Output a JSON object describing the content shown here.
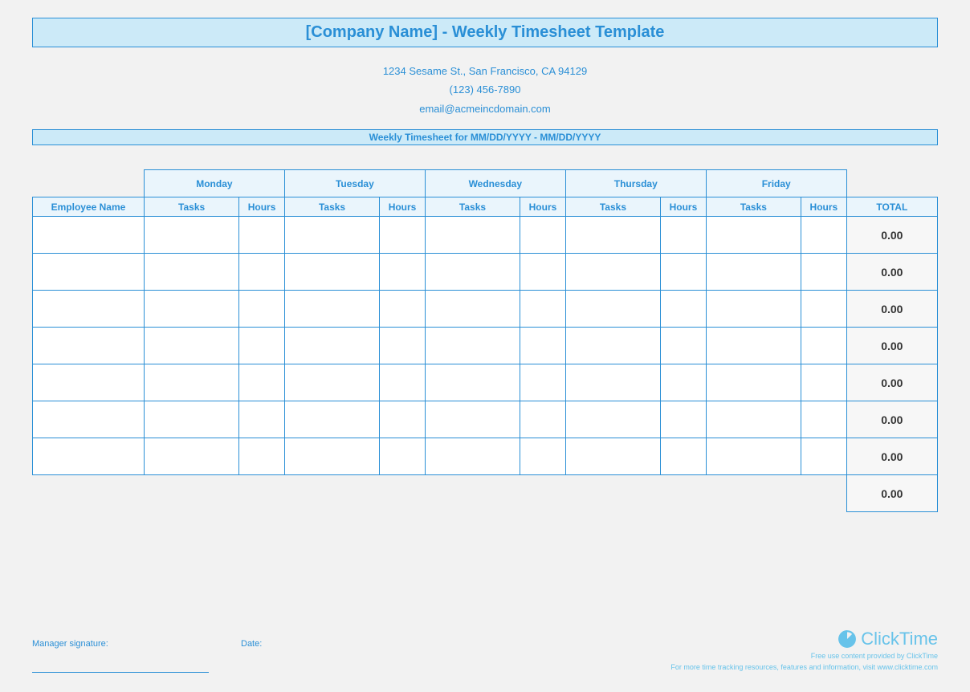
{
  "header": {
    "title": "[Company Name] - Weekly Timesheet Template",
    "address": "1234 Sesame St.,  San Francisco, CA 94129",
    "phone": "(123) 456-7890",
    "email": "email@acmeincdomain.com",
    "week_label": "Weekly Timesheet for MM/DD/YYYY - MM/DD/YYYY"
  },
  "columns": {
    "employee": "Employee Name",
    "days": [
      "Monday",
      "Tuesday",
      "Wednesday",
      "Thursday",
      "Friday"
    ],
    "tasks": "Tasks",
    "hours": "Hours",
    "total": "TOTAL"
  },
  "rows": [
    {
      "total": "0.00"
    },
    {
      "total": "0.00"
    },
    {
      "total": "0.00"
    },
    {
      "total": "0.00"
    },
    {
      "total": "0.00"
    },
    {
      "total": "0.00"
    },
    {
      "total": "0.00"
    }
  ],
  "grand_total": "0.00",
  "footer": {
    "signature": "Manager signature:",
    "date": "Date:",
    "brand": "ClickTime",
    "sub1": "Free use content provided by ClickTime",
    "sub2": "For more time tracking resources, features and information, visit www.clicktime.com"
  }
}
